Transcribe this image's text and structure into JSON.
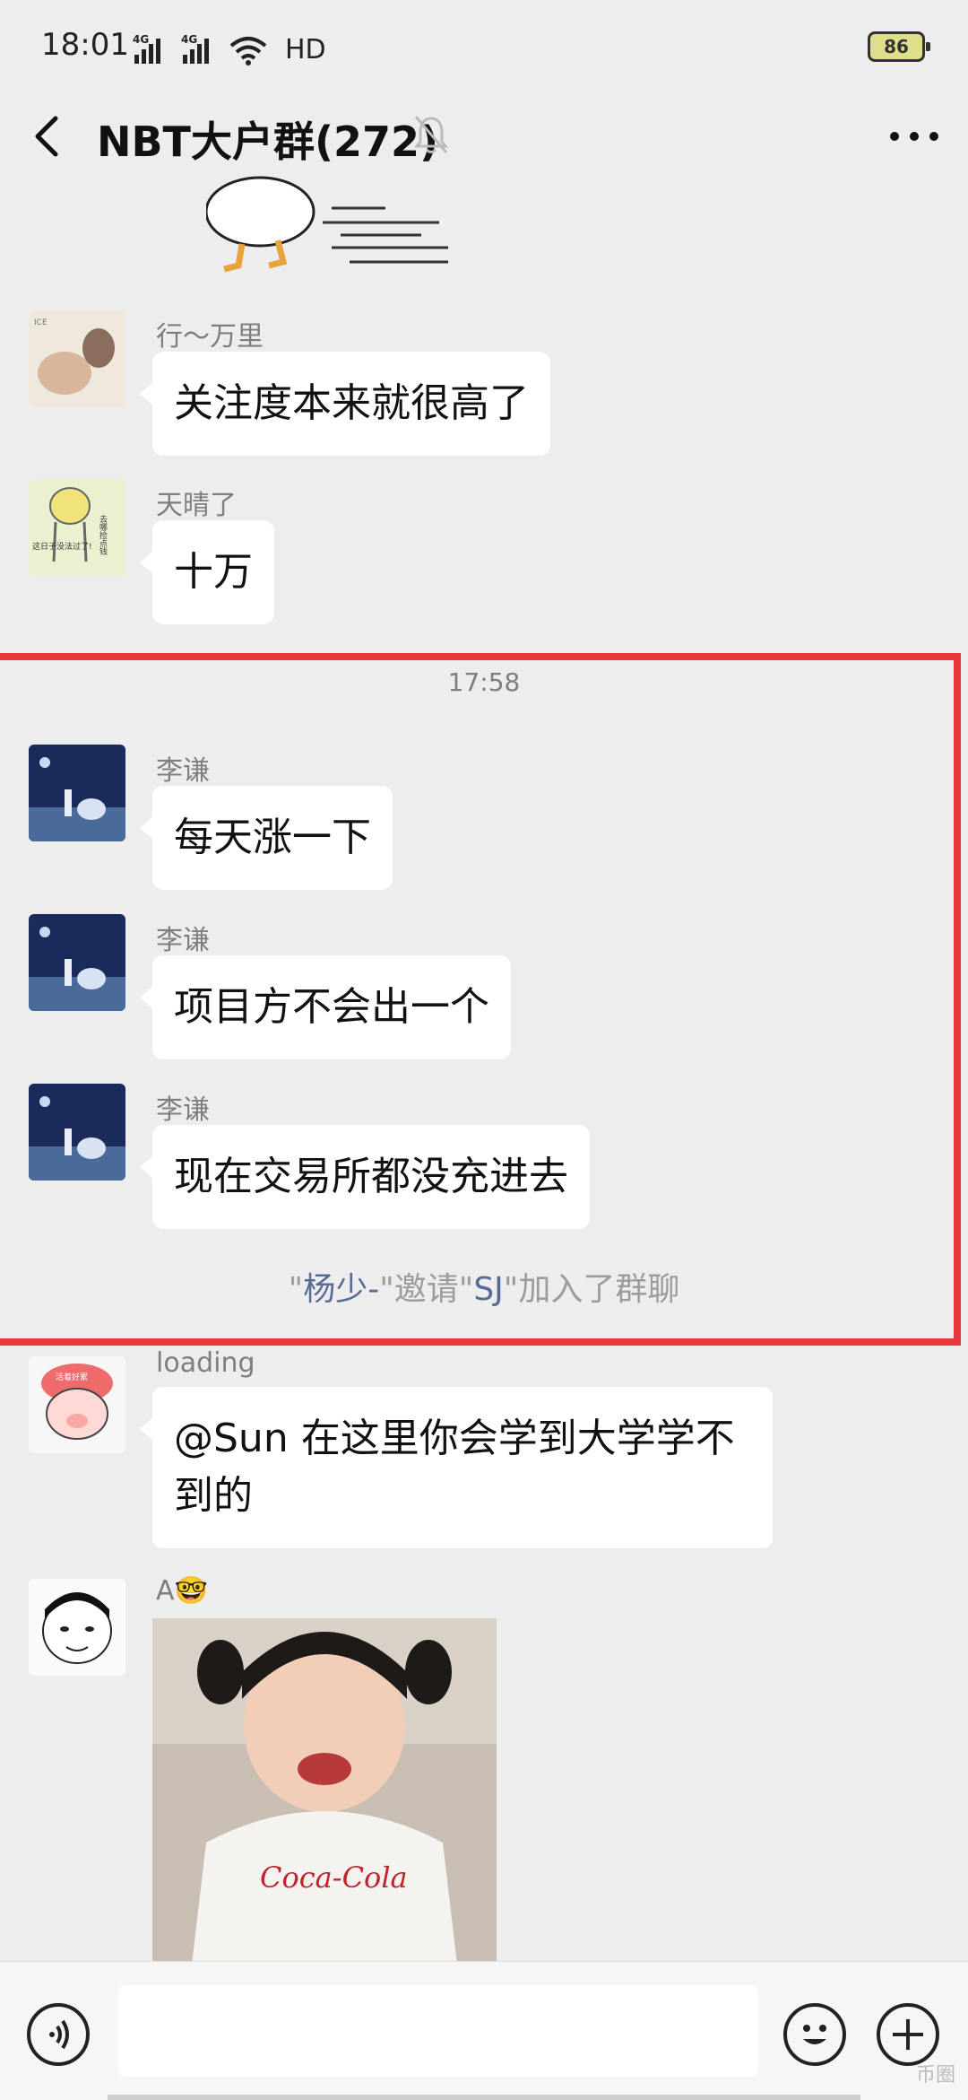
{
  "status_bar": {
    "time": "18:01",
    "signal1": "4G",
    "signal2": "4G",
    "hd": "HD",
    "battery": "86"
  },
  "nav": {
    "title": "NBT大户群(272)"
  },
  "messages": [
    {
      "sender": "行～万里",
      "text": "关注度本来就很高了"
    },
    {
      "sender": "天晴了",
      "text": "十万"
    },
    {
      "sender": "李谦",
      "text": "每天涨一下"
    },
    {
      "sender": "李谦",
      "text": "项目方不会出一个"
    },
    {
      "sender": "李谦",
      "text": "现在交易所都没充进去"
    },
    {
      "sender": "loading",
      "text": "@Sun  在这里你会学到大学学不到的"
    },
    {
      "sender": "A🤓"
    }
  ],
  "time_separator": "17:58",
  "system_note": {
    "q1": "\"",
    "inviter": "杨少-",
    "mid": "\"邀请\"",
    "invitee": "SJ",
    "tail": "\"加入了群聊"
  },
  "avatar_text": {
    "wanli": "ICE",
    "tianqing1": "这日子没法过了!",
    "tianqing2": "去哪捡点钱",
    "loading": "活着好累"
  },
  "photo_text": "Coca-Cola",
  "watermark": "币圈",
  "colors": {
    "background": "#ededed",
    "bubble": "#ffffff",
    "highlight": "#e8363d",
    "link_name": "#576b95"
  }
}
